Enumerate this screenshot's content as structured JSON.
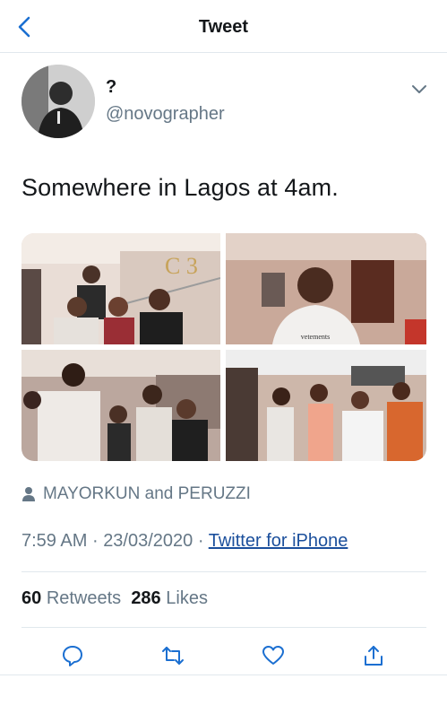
{
  "header": {
    "title": "Tweet",
    "back_icon": "chevron-left-icon"
  },
  "author": {
    "name": "?",
    "handle": "@novographer"
  },
  "tweet": {
    "text": "Somewhere in Lagos at 4am."
  },
  "media": {
    "photos": [
      {
        "name": "photo-1",
        "icon": "photo"
      },
      {
        "name": "photo-2",
        "icon": "photo"
      },
      {
        "name": "photo-3",
        "icon": "photo"
      },
      {
        "name": "photo-4",
        "icon": "photo"
      }
    ]
  },
  "tagged": {
    "text": "MAYORKUN and PERUZZI",
    "icon": "person-icon"
  },
  "meta": {
    "time": "7:59 AM",
    "separator": "·",
    "date": "23/03/2020",
    "source": "Twitter for iPhone"
  },
  "stats": {
    "retweets_count": "60",
    "retweets_label": "Retweets",
    "likes_count": "286",
    "likes_label": "Likes"
  },
  "colors": {
    "accent": "#1b4f9c",
    "muted": "#657786",
    "divider": "#e1e8ed"
  }
}
